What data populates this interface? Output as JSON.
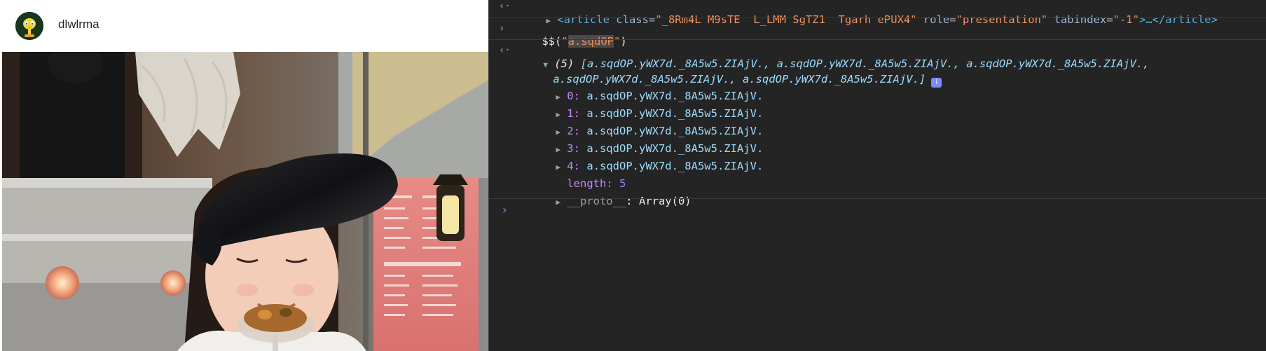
{
  "post": {
    "username": "dlwlrma"
  },
  "console": {
    "element_line": {
      "open": "<",
      "tag": "article",
      "class_attr": " class",
      "class_value": "\"_8Rm4L M9sTE  L_LMM SgTZ1  Tgarh ePUX4\"",
      "role_attr": " role",
      "role_value": "\"presentation\"",
      "tabindex_attr": " tabindex",
      "tabindex_value": "\"-1\"",
      "ellipsis": ">…</",
      "close_tag": "article",
      "close": ">"
    },
    "input_line": {
      "prefix": "$$(",
      "quote_open": "\"",
      "selector": "a.sqdOP",
      "quote_close": "\"",
      "suffix": ")"
    },
    "result_summary": {
      "count": "(5)",
      "line1": " [a.sqdOP.yWX7d._8A5w5.ZIAjV., a.sqdOP.yWX7d._8A5w5.ZIAjV., a.sqdOP.yWX7d._8A5w5.ZIAjV.,",
      "line2": "a.sqdOP.yWX7d._8A5w5.ZIAjV., a.sqdOP.yWX7d._8A5w5.ZIAjV.]",
      "badge": "i"
    },
    "items": [
      {
        "key": "0",
        "value": "a.sqdOP.yWX7d._8A5w5.ZIAjV."
      },
      {
        "key": "1",
        "value": "a.sqdOP.yWX7d._8A5w5.ZIAjV."
      },
      {
        "key": "2",
        "value": "a.sqdOP.yWX7d._8A5w5.ZIAjV."
      },
      {
        "key": "3",
        "value": "a.sqdOP.yWX7d._8A5w5.ZIAjV."
      },
      {
        "key": "4",
        "value": "a.sqdOP.yWX7d._8A5w5.ZIAjV."
      }
    ],
    "length": {
      "key": "length",
      "value": "5"
    },
    "proto": {
      "key": "__proto__",
      "value": "Array(0)"
    },
    "prompt_symbol": "›"
  },
  "colors": {
    "console_bg": "#242424",
    "string": "#f28b54",
    "tag": "#5db0d7",
    "object": "#9cdcfe",
    "key": "#c58af9",
    "number": "#9980ff",
    "prompt": "#4da3ff"
  },
  "icons": {
    "result_arrow": "return-arrow-icon",
    "input_arrow": "input-chevron-icon",
    "expand": "expand-triangle-icon"
  }
}
